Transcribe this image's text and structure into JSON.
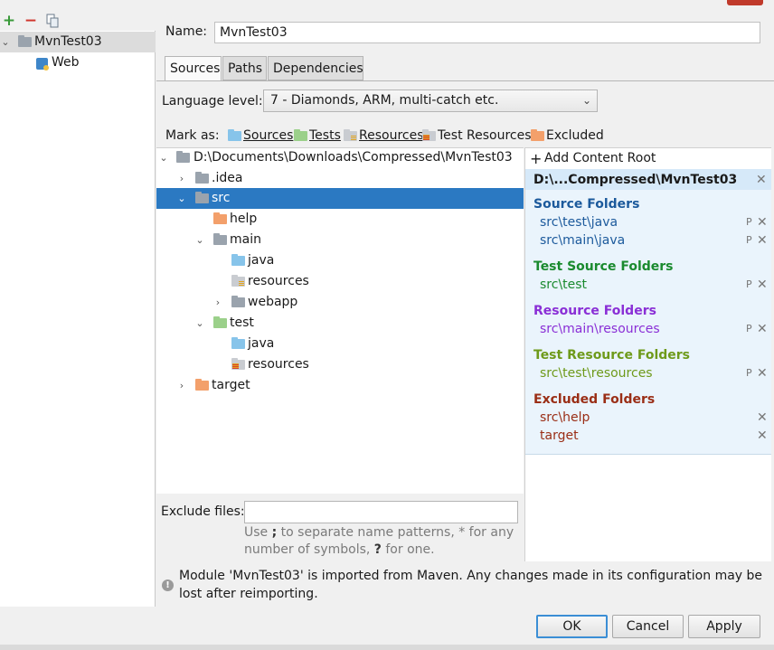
{
  "left": {
    "toolbar": {
      "add_icon": "+",
      "remove_icon": "−",
      "copy_icon": "copy-icon"
    },
    "tree": [
      {
        "label": "MvnTest03"
      },
      {
        "label": "Web"
      }
    ]
  },
  "name_label": "Name:",
  "name_value": "MvnTest03",
  "tabs": [
    "Sources",
    "Paths",
    "Dependencies"
  ],
  "language_label": "Language level:",
  "language_value": "7 - Diamonds, ARM, multi-catch etc.",
  "mark_as_label": "Mark as:",
  "mark_as": [
    "Sources",
    "Tests",
    "Resources",
    "Test Resources",
    "Excluded"
  ],
  "tree": [
    {
      "label": "D:\\Documents\\Downloads\\Compressed\\MvnTest03"
    },
    {
      "label": ".idea"
    },
    {
      "label": "src"
    },
    {
      "label": "help"
    },
    {
      "label": "main"
    },
    {
      "label": "java"
    },
    {
      "label": "resources"
    },
    {
      "label": "webapp"
    },
    {
      "label": "test"
    },
    {
      "label": "java"
    },
    {
      "label": "resources"
    },
    {
      "label": "target"
    }
  ],
  "roots": {
    "add_label": "Add Content Root",
    "root_path": "D:\\...Compressed\\MvnTest03",
    "groups": [
      {
        "title": "Source Folders",
        "color": "#1c5a9c",
        "items": [
          "src\\test\\java",
          "src\\main\\java"
        ]
      },
      {
        "title": "Test Source Folders",
        "color": "#1a8a2e",
        "items": [
          "src\\test"
        ]
      },
      {
        "title": "Resource Folders",
        "color": "#8a2fd6",
        "items": [
          "src\\main\\resources"
        ]
      },
      {
        "title": "Test Resource Folders",
        "color": "#6e9a1a",
        "items": [
          "src\\test\\resources"
        ]
      },
      {
        "title": "Excluded Folders",
        "color": "#9a2e16",
        "items": [
          "src\\help",
          "target"
        ]
      }
    ]
  },
  "exclude": {
    "label": "Exclude files:",
    "value": "",
    "hint_line1_pre": "Use ",
    "hint_line1_bold": ";",
    "hint_line1_post": " to separate name patterns, * for any",
    "hint_line2_pre": "number of symbols, ",
    "hint_line2_bold": "?",
    "hint_line2_post": " for one."
  },
  "info": {
    "line1": "Module 'MvnTest03' is imported from Maven. Any changes made in its configuration may be",
    "line2": "lost after reimporting."
  },
  "buttons": {
    "ok": "OK",
    "cancel": "Cancel",
    "apply": "Apply"
  }
}
